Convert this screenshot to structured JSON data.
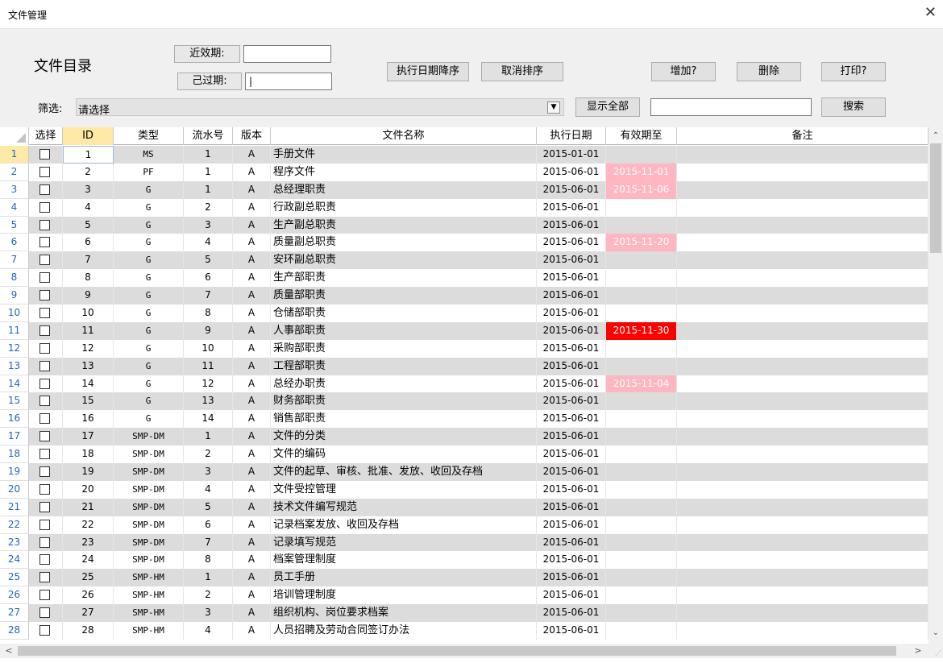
{
  "window": {
    "title": "文件管理",
    "close_glyph": "✕"
  },
  "header": {
    "section_title": "文件目录",
    "near_expiry_label": "近效期:",
    "expired_label": "己过期:",
    "near_expiry_value": "",
    "expired_value": "|",
    "sort_desc_button": "执行日期降序",
    "cancel_sort_button": "取消排序",
    "add_button": "增加?",
    "delete_button": "删除",
    "print_button": "打印?",
    "filter_label": "筛选:",
    "filter_value": "请选择",
    "show_all_button": "显示全部",
    "search_value": "",
    "search_button": "搜索"
  },
  "colors": {
    "near_expiry": "#ffb6c1",
    "expired": "#ff0000",
    "alt_row": "#dcdcdc",
    "row_number": "#1e66c8"
  },
  "grid": {
    "columns": [
      "选择",
      "ID",
      "类型",
      "流水号",
      "版本",
      "文件名称",
      "执行日期",
      "有效期至",
      "备注"
    ],
    "rows": [
      {
        "n": "1",
        "id": "1",
        "type": "MS",
        "seq": "1",
        "ver": "A",
        "name": "手册文件",
        "date": "2015-01-01",
        "valid": "",
        "status": "",
        "note": ""
      },
      {
        "n": "2",
        "id": "2",
        "type": "PF",
        "seq": "1",
        "ver": "A",
        "name": "程序文件",
        "date": "2015-06-01",
        "valid": "2015-11-01",
        "status": "near",
        "note": ""
      },
      {
        "n": "3",
        "id": "3",
        "type": "G",
        "seq": "1",
        "ver": "A",
        "name": "总经理职责",
        "date": "2015-06-01",
        "valid": "2015-11-06",
        "status": "near",
        "note": ""
      },
      {
        "n": "4",
        "id": "4",
        "type": "G",
        "seq": "2",
        "ver": "A",
        "name": "行政副总职责",
        "date": "2015-06-01",
        "valid": "",
        "status": "",
        "note": ""
      },
      {
        "n": "5",
        "id": "5",
        "type": "G",
        "seq": "3",
        "ver": "A",
        "name": "生产副总职责",
        "date": "2015-06-01",
        "valid": "",
        "status": "",
        "note": ""
      },
      {
        "n": "6",
        "id": "6",
        "type": "G",
        "seq": "4",
        "ver": "A",
        "name": "质量副总职责",
        "date": "2015-06-01",
        "valid": "2015-11-20",
        "status": "near",
        "note": ""
      },
      {
        "n": "7",
        "id": "7",
        "type": "G",
        "seq": "5",
        "ver": "A",
        "name": "安环副总职责",
        "date": "2015-06-01",
        "valid": "",
        "status": "",
        "note": ""
      },
      {
        "n": "8",
        "id": "8",
        "type": "G",
        "seq": "6",
        "ver": "A",
        "name": "生产部职责",
        "date": "2015-06-01",
        "valid": "",
        "status": "",
        "note": ""
      },
      {
        "n": "9",
        "id": "9",
        "type": "G",
        "seq": "7",
        "ver": "A",
        "name": "质量部职责",
        "date": "2015-06-01",
        "valid": "",
        "status": "",
        "note": ""
      },
      {
        "n": "10",
        "id": "10",
        "type": "G",
        "seq": "8",
        "ver": "A",
        "name": "仓储部职责",
        "date": "2015-06-01",
        "valid": "",
        "status": "",
        "note": ""
      },
      {
        "n": "11",
        "id": "11",
        "type": "G",
        "seq": "9",
        "ver": "A",
        "name": "人事部职责",
        "date": "2015-06-01",
        "valid": "2015-11-30",
        "status": "expired",
        "note": ""
      },
      {
        "n": "12",
        "id": "12",
        "type": "G",
        "seq": "10",
        "ver": "A",
        "name": "采购部职责",
        "date": "2015-06-01",
        "valid": "",
        "status": "",
        "note": ""
      },
      {
        "n": "13",
        "id": "13",
        "type": "G",
        "seq": "11",
        "ver": "A",
        "name": "工程部职责",
        "date": "2015-06-01",
        "valid": "",
        "status": "",
        "note": ""
      },
      {
        "n": "14",
        "id": "14",
        "type": "G",
        "seq": "12",
        "ver": "A",
        "name": "总经办职责",
        "date": "2015-06-01",
        "valid": "2015-11-04",
        "status": "near",
        "note": ""
      },
      {
        "n": "15",
        "id": "15",
        "type": "G",
        "seq": "13",
        "ver": "A",
        "name": "财务部职责",
        "date": "2015-06-01",
        "valid": "",
        "status": "",
        "note": ""
      },
      {
        "n": "16",
        "id": "16",
        "type": "G",
        "seq": "14",
        "ver": "A",
        "name": "销售部职责",
        "date": "2015-06-01",
        "valid": "",
        "status": "",
        "note": ""
      },
      {
        "n": "17",
        "id": "17",
        "type": "SMP-DM",
        "seq": "1",
        "ver": "A",
        "name": "文件的分类",
        "date": "2015-06-01",
        "valid": "",
        "status": "",
        "note": ""
      },
      {
        "n": "18",
        "id": "18",
        "type": "SMP-DM",
        "seq": "2",
        "ver": "A",
        "name": "文件的编码",
        "date": "2015-06-01",
        "valid": "",
        "status": "",
        "note": ""
      },
      {
        "n": "19",
        "id": "19",
        "type": "SMP-DM",
        "seq": "3",
        "ver": "A",
        "name": "文件的起草、审核、批准、发放、收回及存档",
        "date": "2015-06-01",
        "valid": "",
        "status": "",
        "note": ""
      },
      {
        "n": "20",
        "id": "20",
        "type": "SMP-DM",
        "seq": "4",
        "ver": "A",
        "name": "文件受控管理",
        "date": "2015-06-01",
        "valid": "",
        "status": "",
        "note": ""
      },
      {
        "n": "21",
        "id": "21",
        "type": "SMP-DM",
        "seq": "5",
        "ver": "A",
        "name": "技术文件编写规范",
        "date": "2015-06-01",
        "valid": "",
        "status": "",
        "note": ""
      },
      {
        "n": "22",
        "id": "22",
        "type": "SMP-DM",
        "seq": "6",
        "ver": "A",
        "name": "记录档案发放、收回及存档",
        "date": "2015-06-01",
        "valid": "",
        "status": "",
        "note": ""
      },
      {
        "n": "23",
        "id": "23",
        "type": "SMP-DM",
        "seq": "7",
        "ver": "A",
        "name": "记录填写规范",
        "date": "2015-06-01",
        "valid": "",
        "status": "",
        "note": ""
      },
      {
        "n": "24",
        "id": "24",
        "type": "SMP-DM",
        "seq": "8",
        "ver": "A",
        "name": "档案管理制度",
        "date": "2015-06-01",
        "valid": "",
        "status": "",
        "note": ""
      },
      {
        "n": "25",
        "id": "25",
        "type": "SMP-HM",
        "seq": "1",
        "ver": "A",
        "name": "员工手册",
        "date": "2015-06-01",
        "valid": "",
        "status": "",
        "note": ""
      },
      {
        "n": "26",
        "id": "26",
        "type": "SMP-HM",
        "seq": "2",
        "ver": "A",
        "name": "培训管理制度",
        "date": "2015-06-01",
        "valid": "",
        "status": "",
        "note": ""
      },
      {
        "n": "27",
        "id": "27",
        "type": "SMP-HM",
        "seq": "3",
        "ver": "A",
        "name": "组织机构、岗位要求档案",
        "date": "2015-06-01",
        "valid": "",
        "status": "",
        "note": ""
      },
      {
        "n": "28",
        "id": "28",
        "type": "SMP-HM",
        "seq": "4",
        "ver": "A",
        "name": "人员招聘及劳动合同签订办法",
        "date": "2015-06-01",
        "valid": "",
        "status": "",
        "note": ""
      }
    ]
  },
  "scroll": {
    "up": "⌃",
    "down": "⌄",
    "left": "<",
    "right": ">"
  }
}
